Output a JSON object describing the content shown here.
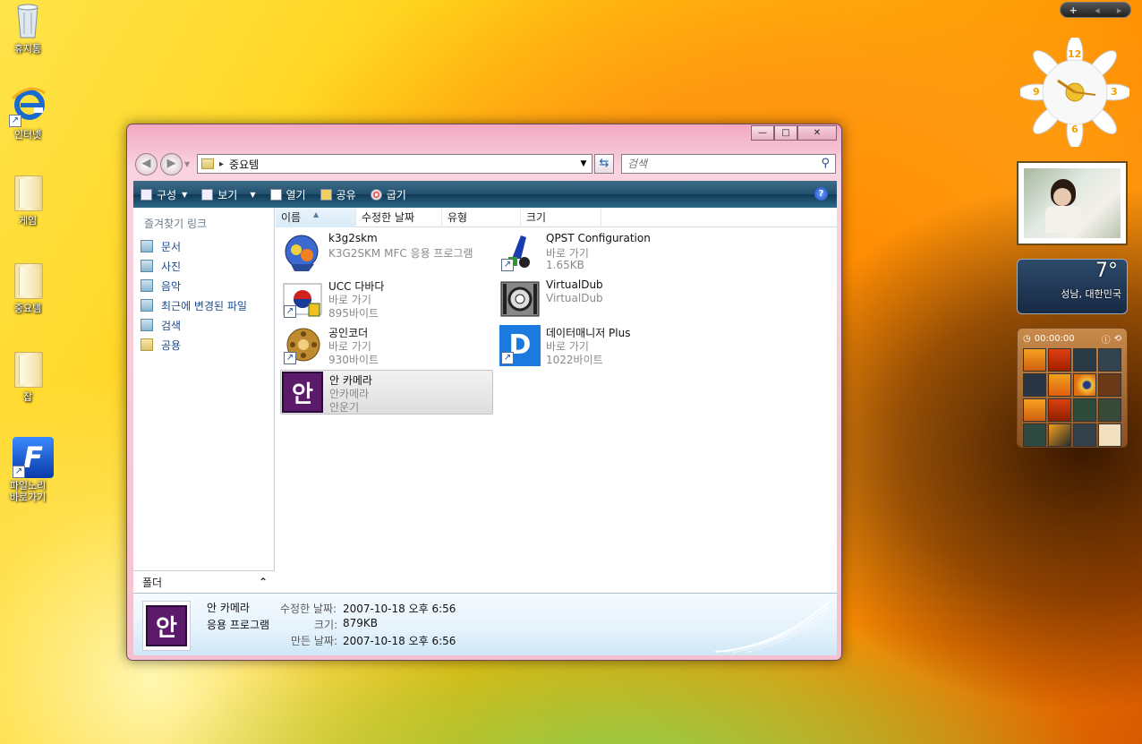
{
  "desktop": {
    "icons": [
      {
        "label": "휴지통"
      },
      {
        "label": "인터넷"
      },
      {
        "label": "게임"
      },
      {
        "label": "중요템"
      },
      {
        "label": "잡"
      },
      {
        "label": "파일노리\n바로가기"
      }
    ]
  },
  "sidebar": {
    "toolbar": {
      "add": "+",
      "prev": "◂",
      "next": "▸"
    },
    "clock": {
      "n12": "12",
      "n3": "3",
      "n6": "6",
      "n9": "9"
    },
    "weather": {
      "temp": "7°",
      "city": "성남, 대한민국"
    },
    "puzzle": {
      "timer": "00:00:00"
    }
  },
  "window": {
    "controls": {
      "minimize": "—",
      "maximize": "□",
      "close": "✕"
    },
    "nav": {
      "back": "◀",
      "forward": "▶"
    },
    "address": {
      "path": "중요템",
      "sep": "▸"
    },
    "search": {
      "placeholder": "검색"
    },
    "toolbar": {
      "organize": "구성",
      "views": "보기",
      "open": "열기",
      "share": "공유",
      "burn": "굽기",
      "help": "?"
    },
    "nav_pane": {
      "title": "즐겨찾기 링크",
      "links": [
        "문서",
        "사진",
        "음악",
        "최근에 변경된 파일",
        "검색",
        "공용"
      ],
      "folders": "폴더",
      "folders_caret": "⌃"
    },
    "columns": [
      "이름",
      "수정한 날짜",
      "유형",
      "크기"
    ],
    "files": [
      {
        "name": "k3g2skm",
        "line2": "K3G2SKM MFC 응용 프로그램",
        "line3": ""
      },
      {
        "name": "QPST Configuration",
        "line2": "바로 가기",
        "line3": "1.65KB"
      },
      {
        "name": "UCC 다바다",
        "line2": "바로 가기",
        "line3": "895바이트"
      },
      {
        "name": "VirtualDub",
        "line2": "VirtualDub",
        "line3": ""
      },
      {
        "name": "공인코더",
        "line2": "바로 가기",
        "line3": "930바이트"
      },
      {
        "name": "데이터매니저 Plus",
        "line2": "바로 가기",
        "line3": "1022바이트"
      },
      {
        "name": "안 카메라",
        "line2": "안카메라",
        "line3": "안운기"
      }
    ],
    "details": {
      "name": "안 카메라",
      "type": "응용 프로그램",
      "modified_label": "수정한 날짜:",
      "modified": "2007-10-18 오후 6:56",
      "size_label": "크기:",
      "size": "879KB",
      "created_label": "만든 날짜:",
      "created": "2007-10-18 오후 6:56",
      "thumb_glyph": "안"
    }
  },
  "colors": {
    "toolbar_bg": "#21506e",
    "link_blue": "#1a4a8a",
    "window_frame": "#f5c0d0"
  }
}
